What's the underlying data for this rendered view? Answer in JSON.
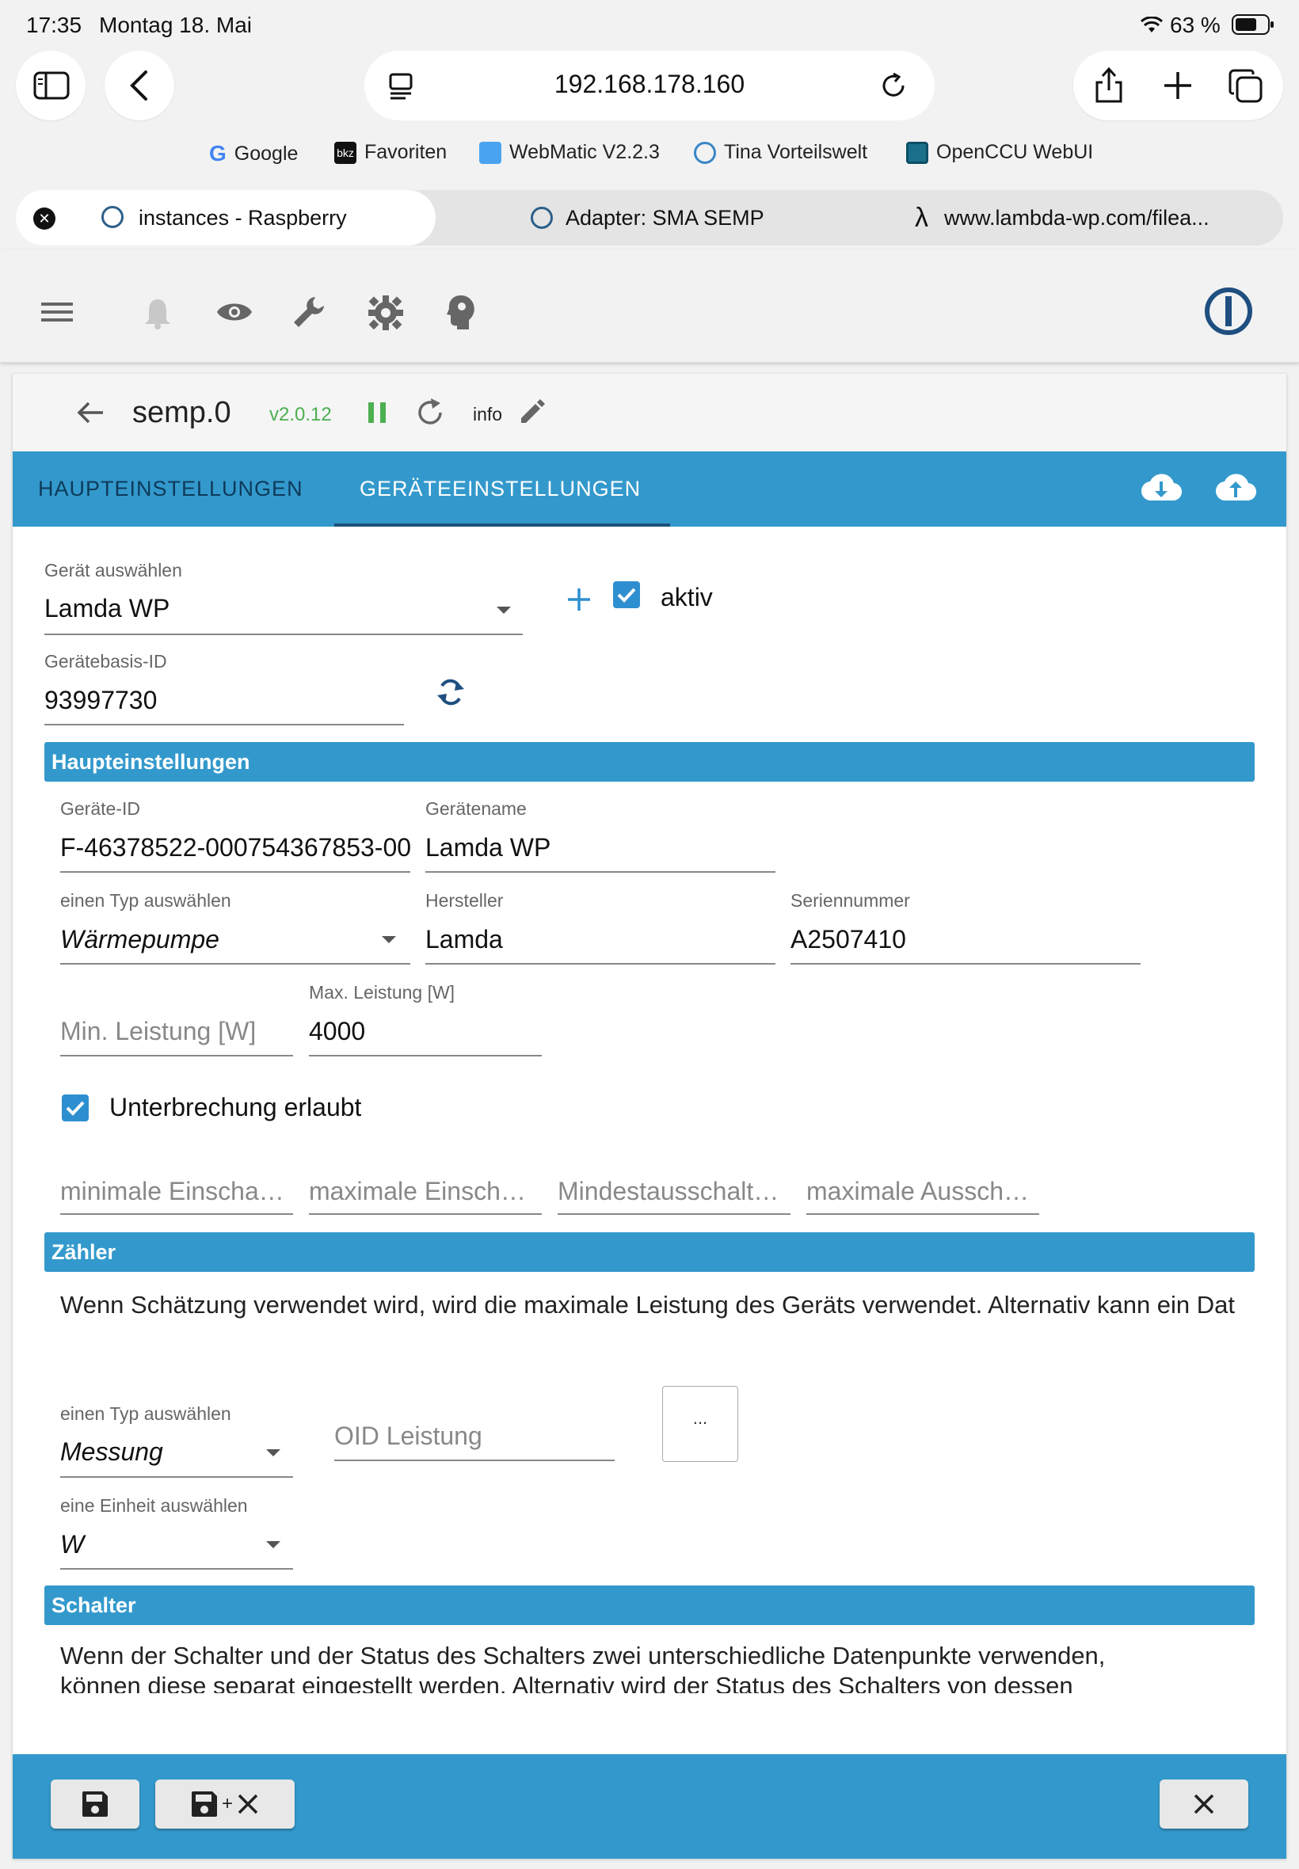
{
  "status_bar": {
    "time": "17:35",
    "date": "Montag 18. Mai",
    "battery": "63 %"
  },
  "browser": {
    "url": "192.168.178.160",
    "bookmarks": [
      "Google",
      "Favoriten",
      "WebMatic V2.2.3",
      "Tina Vorteilswelt",
      "OpenCCU WebUI"
    ],
    "tabs": [
      "instances - Raspberry",
      "Adapter: SMA SEMP",
      "www.lambda-wp.com/filea..."
    ]
  },
  "instance": {
    "name": "semp.0",
    "version": "v2.0.12",
    "info": "info"
  },
  "tabs": {
    "main": "HAUPTEINSTELLUNGEN",
    "devices": "GERÄTEEINSTELLUNGEN"
  },
  "device_select": {
    "label": "Gerät auswählen",
    "value": "Lamda WP",
    "active_label": "aktiv",
    "active": true
  },
  "base_id": {
    "label": "Gerätebasis-ID",
    "value": "93997730"
  },
  "sections": {
    "main": "Haupteinstellungen",
    "counter": "Zähler",
    "switch": "Schalter"
  },
  "main_settings": {
    "device_id_label": "Geräte-ID",
    "device_id": "F-46378522-000754367853-00",
    "device_name_label": "Gerätename",
    "device_name": "Lamda WP",
    "type_label": "einen Typ auswählen",
    "type": "Wärmepumpe",
    "vendor_label": "Hersteller",
    "vendor": "Lamda",
    "serial_label": "Seriennummer",
    "serial": "A2507410",
    "min_power_placeholder": "Min. Leistung [W]",
    "max_power_label": "Max. Leistung [W]",
    "max_power": "4000",
    "interrupt_label": "Unterbrechung erlaubt",
    "interrupt": true,
    "min_on_placeholder": "minimale Einscha…",
    "max_on_placeholder": "maximale Einsch…",
    "min_off_placeholder": "Mindestausschalt…",
    "max_off_placeholder": "maximale Aussch…"
  },
  "counter": {
    "description": "Wenn Schätzung verwendet wird, wird die maximale Leistung des Geräts verwendet. Alternativ kann ein Dat",
    "type_label": "einen Typ auswählen",
    "type": "Messung",
    "oid_placeholder": "OID Leistung",
    "browse_label": "...",
    "unit_label": "eine Einheit auswählen",
    "unit": "W"
  },
  "switch": {
    "description_line1": "Wenn der Schalter und der Status des Schalters zwei unterschiedliche Datenpunkte verwenden,",
    "description_line2": "können diese separat eingestellt werden. Alternativ wird der Status des Schalters von dessen"
  },
  "colors": {
    "accent": "#3399cc",
    "version": "#4caf50",
    "checkbox": "#2e8fd0"
  }
}
